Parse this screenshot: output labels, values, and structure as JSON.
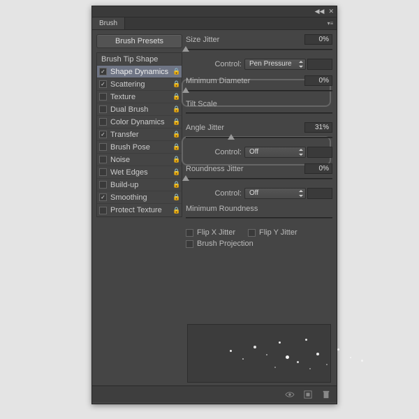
{
  "header": {
    "title": "Brush"
  },
  "sidebar": {
    "presets_btn": "Brush Presets",
    "tip_shape": "Brush Tip Shape",
    "items": [
      {
        "label": "Shape Dynamics",
        "checked": true,
        "lock": true,
        "selected": true
      },
      {
        "label": "Scattering",
        "checked": true,
        "lock": true
      },
      {
        "label": "Texture",
        "checked": false,
        "lock": true
      },
      {
        "label": "Dual Brush",
        "checked": false,
        "lock": true
      },
      {
        "label": "Color Dynamics",
        "checked": false,
        "lock": true
      },
      {
        "label": "Transfer",
        "checked": true,
        "lock": true
      },
      {
        "label": "Brush Pose",
        "checked": false,
        "lock": true
      },
      {
        "label": "Noise",
        "checked": false,
        "lock": true
      },
      {
        "label": "Wet Edges",
        "checked": false,
        "lock": true
      },
      {
        "label": "Build-up",
        "checked": false,
        "lock": true
      },
      {
        "label": "Smoothing",
        "checked": true,
        "lock": true
      },
      {
        "label": "Protect Texture",
        "checked": false,
        "lock": true
      }
    ]
  },
  "content": {
    "size_jitter": {
      "label": "Size Jitter",
      "value": "0%",
      "thumb_pct": 0
    },
    "control1": {
      "label": "Control:",
      "value": "Pen Pressure"
    },
    "min_diameter": {
      "label": "Minimum Diameter",
      "value": "0%",
      "thumb_pct": 0
    },
    "tilt_scale": {
      "label": "Tilt Scale"
    },
    "angle_jitter": {
      "label": "Angle Jitter",
      "value": "31%",
      "thumb_pct": 31
    },
    "control2": {
      "label": "Control:",
      "value": "Off"
    },
    "roundness_jitter": {
      "label": "Roundness Jitter",
      "value": "0%",
      "thumb_pct": 0
    },
    "control3": {
      "label": "Control:",
      "value": "Off"
    },
    "min_roundness": {
      "label": "Minimum Roundness"
    },
    "flip_x": "Flip X Jitter",
    "flip_y": "Flip Y Jitter",
    "brush_projection": "Brush Projection"
  }
}
